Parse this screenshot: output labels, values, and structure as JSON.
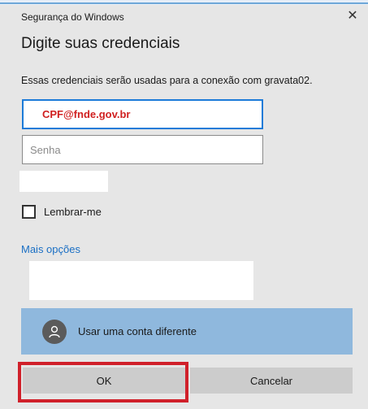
{
  "dialog": {
    "window_title": "Segurança do Windows",
    "close_glyph": "✕",
    "heading": "Digite suas credenciais",
    "description": "Essas credenciais serão usadas para a conexão com gravata02.",
    "username_value": "CPF@fnde.gov.br",
    "password_placeholder": "Senha",
    "remember_label": "Lembrar-me",
    "remember_checked": false,
    "more_options_label": "Mais opções",
    "different_account_label": "Usar uma conta diferente",
    "ok_label": "OK",
    "cancel_label": "Cancelar"
  },
  "icons": {
    "close": "close-icon",
    "avatar": "user-avatar-icon"
  },
  "colors": {
    "accent_blue": "#1c7bd8",
    "link_blue": "#1a6fc4",
    "selected_account_bg": "#8fb8dd",
    "highlight_red": "#d0202a",
    "username_text": "#d02020"
  }
}
